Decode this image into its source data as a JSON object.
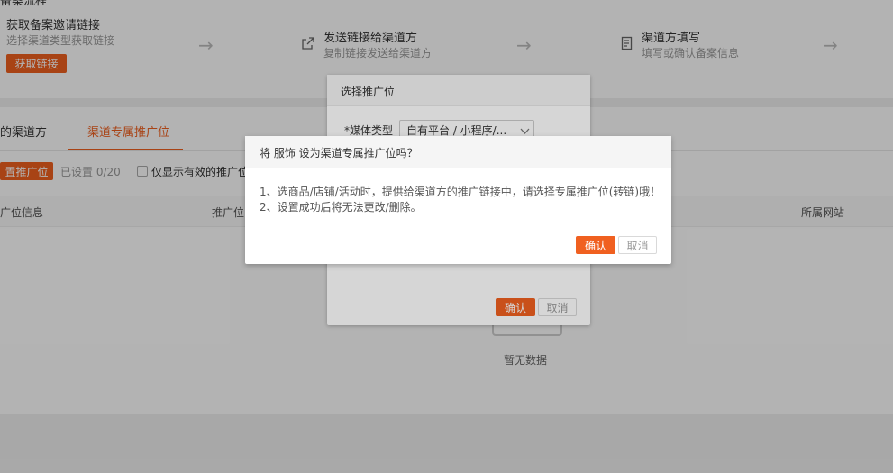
{
  "top_section": {
    "cut_title": "备案流程",
    "steps": [
      {
        "title": "获取备案邀请链接",
        "subtitle": "选择渠道类型获取链接",
        "button": "获取链接"
      },
      {
        "title": "发送链接给渠道方",
        "subtitle": "复制链接发送给渠道方",
        "icon": "share-icon"
      },
      {
        "title": "渠道方填写",
        "subtitle": "填写或确认备案信息",
        "icon": "form-icon"
      }
    ],
    "arrow_glyph": "→"
  },
  "tabs": [
    {
      "label": "的渠道方",
      "active": false
    },
    {
      "label": "渠道专属推广位",
      "active": true
    }
  ],
  "toolbar": {
    "set_button": "置推广位",
    "count_label": "已设置",
    "count_value": "0/20",
    "checkbox_label": "仅显示有效的推广位"
  },
  "table": {
    "headers": [
      "广位信息",
      "推广位",
      "所属网站"
    ]
  },
  "empty_text": "暂无数据",
  "dialog_select": {
    "title": "选择推广位",
    "media_label": "*媒体类型",
    "media_value": "自有平台 / 小程序/...",
    "confirm": "确认",
    "cancel": "取消"
  },
  "dialog_confirm": {
    "title": "将 服饰 设为渠道专属推广位吗？",
    "line1": "1、选商品/店铺/活动时，提供给渠道方的推广链接中，请选择专属推广位(转链)哦！",
    "line2": "2、设置成功后将无法更改/删除。",
    "confirm": "确认",
    "cancel": "取消"
  },
  "colors": {
    "accent": "#f06020",
    "muted": "#999999"
  }
}
